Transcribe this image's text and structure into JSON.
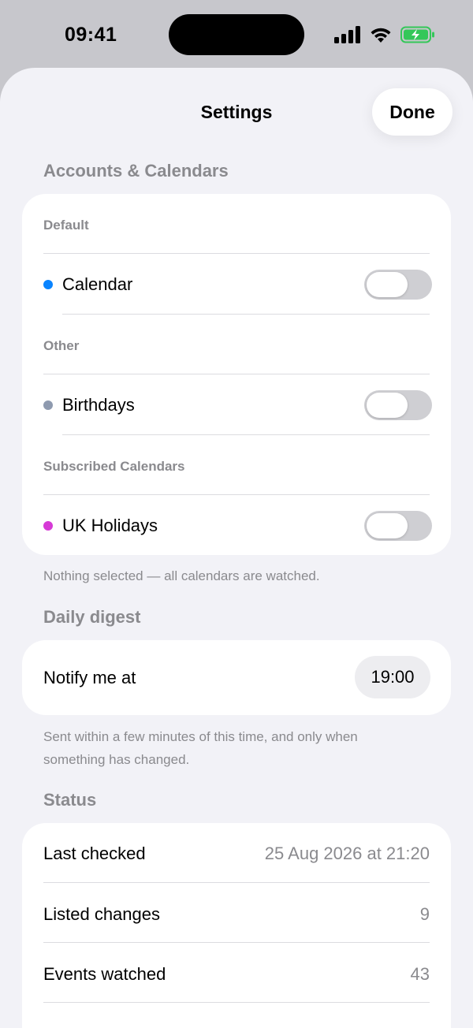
{
  "status_bar": {
    "time": "09:41",
    "icons": [
      "cellular-signal-icon",
      "wifi-icon",
      "battery-charging-icon"
    ],
    "battery_color": "#34c759"
  },
  "header": {
    "title": "Settings",
    "done_label": "Done"
  },
  "accounts": {
    "section_title": "Accounts & Calendars",
    "groups": [
      {
        "label": "Default",
        "calendars": [
          {
            "name": "Calendar",
            "color": "#0a84ff",
            "enabled": false
          }
        ]
      },
      {
        "label": "Other",
        "calendars": [
          {
            "name": "Birthdays",
            "color": "#8e9aaf",
            "enabled": false
          }
        ]
      },
      {
        "label": "Subscribed Calendars",
        "calendars": [
          {
            "name": "UK Holidays",
            "color": "#d63ad6",
            "enabled": false
          }
        ]
      }
    ],
    "footer": "Nothing selected — all calendars are watched."
  },
  "digest": {
    "section_title": "Daily digest",
    "notify_label": "Notify me at",
    "notify_time": "19:00",
    "footer": "Sent within a few minutes of this time, and only when something has changed."
  },
  "status": {
    "section_title": "Status",
    "rows": [
      {
        "label": "Last checked",
        "value": "25 Aug 2026 at 21:20"
      },
      {
        "label": "Listed changes",
        "value": "9"
      },
      {
        "label": "Events watched",
        "value": "43"
      }
    ],
    "action_color": "#007aff"
  }
}
